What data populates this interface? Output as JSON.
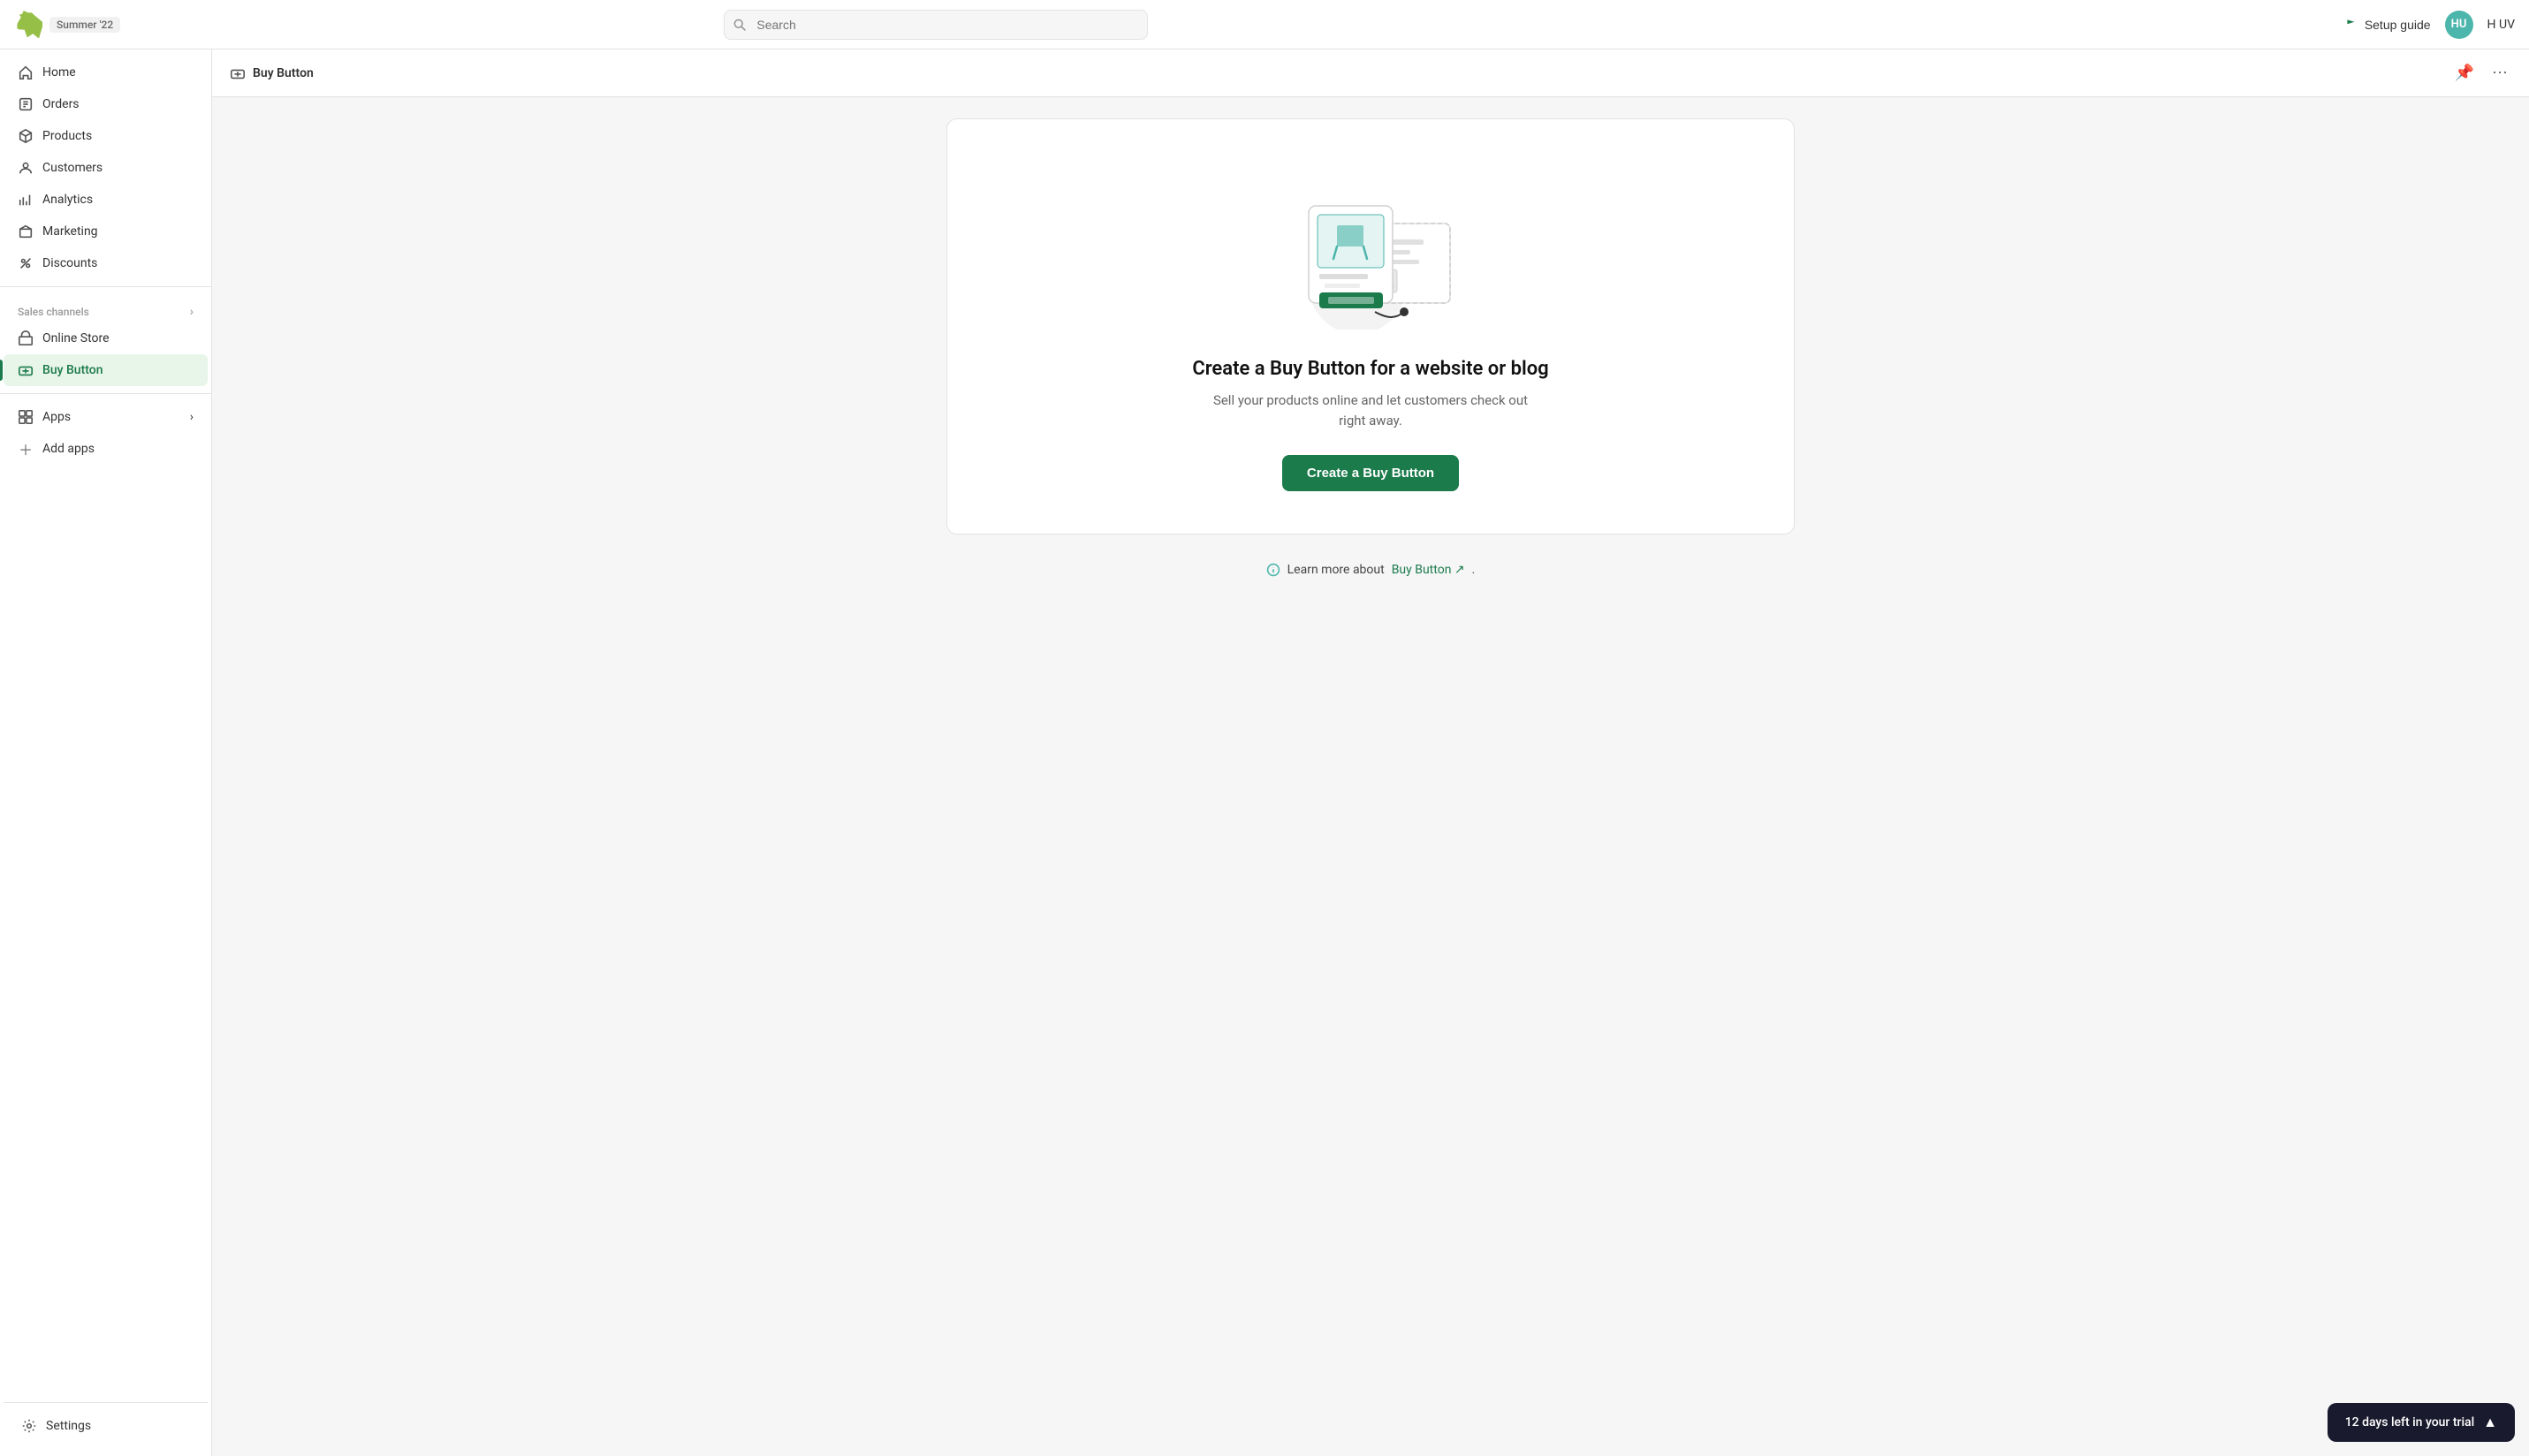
{
  "topnav": {
    "logo_alt": "Shopify",
    "badge_label": "Summer '22",
    "search_placeholder": "Search",
    "setup_guide_label": "Setup guide",
    "avatar_initials": "HU",
    "avatar_name": "H UV"
  },
  "sidebar": {
    "nav_items": [
      {
        "id": "home",
        "label": "Home",
        "icon": "home"
      },
      {
        "id": "orders",
        "label": "Orders",
        "icon": "orders"
      },
      {
        "id": "products",
        "label": "Products",
        "icon": "products"
      },
      {
        "id": "customers",
        "label": "Customers",
        "icon": "customers"
      },
      {
        "id": "analytics",
        "label": "Analytics",
        "icon": "analytics"
      },
      {
        "id": "marketing",
        "label": "Marketing",
        "icon": "marketing"
      },
      {
        "id": "discounts",
        "label": "Discounts",
        "icon": "discounts"
      }
    ],
    "sales_channels_label": "Sales channels",
    "sales_channels": [
      {
        "id": "online-store",
        "label": "Online Store",
        "icon": "store"
      },
      {
        "id": "buy-button",
        "label": "Buy Button",
        "icon": "buy-button",
        "active": true
      }
    ],
    "apps_label": "Apps",
    "add_apps_label": "Add apps",
    "settings_label": "Settings"
  },
  "page": {
    "header_title": "Buy Button",
    "card": {
      "title": "Create a Buy Button for a website or blog",
      "description": "Sell your products online and let customers check out right away.",
      "cta_label": "Create a Buy Button"
    },
    "learn_more_prefix": "Learn more about",
    "learn_more_link_label": "Buy Button",
    "learn_more_suffix": "."
  },
  "trial_banner": {
    "label": "12 days left in your trial",
    "chevron": "▲"
  }
}
